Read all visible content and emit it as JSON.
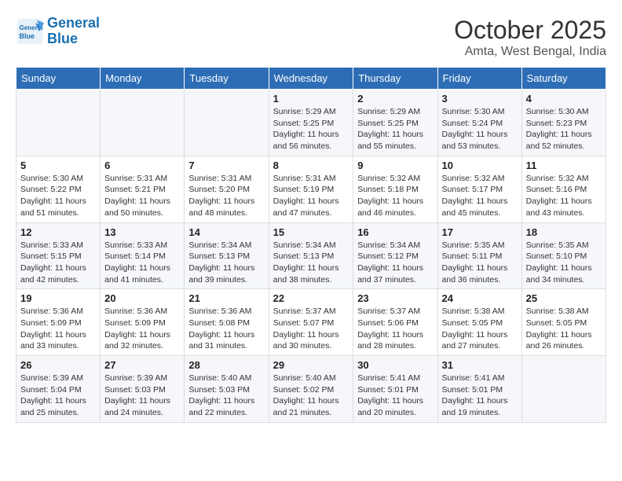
{
  "header": {
    "logo_line1": "General",
    "logo_line2": "Blue",
    "title": "October 2025",
    "subtitle": "Amta, West Bengal, India"
  },
  "weekdays": [
    "Sunday",
    "Monday",
    "Tuesday",
    "Wednesday",
    "Thursday",
    "Friday",
    "Saturday"
  ],
  "weeks": [
    [
      {
        "day": "",
        "info": ""
      },
      {
        "day": "",
        "info": ""
      },
      {
        "day": "",
        "info": ""
      },
      {
        "day": "1",
        "info": "Sunrise: 5:29 AM\nSunset: 5:25 PM\nDaylight: 11 hours and 56 minutes."
      },
      {
        "day": "2",
        "info": "Sunrise: 5:29 AM\nSunset: 5:25 PM\nDaylight: 11 hours and 55 minutes."
      },
      {
        "day": "3",
        "info": "Sunrise: 5:30 AM\nSunset: 5:24 PM\nDaylight: 11 hours and 53 minutes."
      },
      {
        "day": "4",
        "info": "Sunrise: 5:30 AM\nSunset: 5:23 PM\nDaylight: 11 hours and 52 minutes."
      }
    ],
    [
      {
        "day": "5",
        "info": "Sunrise: 5:30 AM\nSunset: 5:22 PM\nDaylight: 11 hours and 51 minutes."
      },
      {
        "day": "6",
        "info": "Sunrise: 5:31 AM\nSunset: 5:21 PM\nDaylight: 11 hours and 50 minutes."
      },
      {
        "day": "7",
        "info": "Sunrise: 5:31 AM\nSunset: 5:20 PM\nDaylight: 11 hours and 48 minutes."
      },
      {
        "day": "8",
        "info": "Sunrise: 5:31 AM\nSunset: 5:19 PM\nDaylight: 11 hours and 47 minutes."
      },
      {
        "day": "9",
        "info": "Sunrise: 5:32 AM\nSunset: 5:18 PM\nDaylight: 11 hours and 46 minutes."
      },
      {
        "day": "10",
        "info": "Sunrise: 5:32 AM\nSunset: 5:17 PM\nDaylight: 11 hours and 45 minutes."
      },
      {
        "day": "11",
        "info": "Sunrise: 5:32 AM\nSunset: 5:16 PM\nDaylight: 11 hours and 43 minutes."
      }
    ],
    [
      {
        "day": "12",
        "info": "Sunrise: 5:33 AM\nSunset: 5:15 PM\nDaylight: 11 hours and 42 minutes."
      },
      {
        "day": "13",
        "info": "Sunrise: 5:33 AM\nSunset: 5:14 PM\nDaylight: 11 hours and 41 minutes."
      },
      {
        "day": "14",
        "info": "Sunrise: 5:34 AM\nSunset: 5:13 PM\nDaylight: 11 hours and 39 minutes."
      },
      {
        "day": "15",
        "info": "Sunrise: 5:34 AM\nSunset: 5:13 PM\nDaylight: 11 hours and 38 minutes."
      },
      {
        "day": "16",
        "info": "Sunrise: 5:34 AM\nSunset: 5:12 PM\nDaylight: 11 hours and 37 minutes."
      },
      {
        "day": "17",
        "info": "Sunrise: 5:35 AM\nSunset: 5:11 PM\nDaylight: 11 hours and 36 minutes."
      },
      {
        "day": "18",
        "info": "Sunrise: 5:35 AM\nSunset: 5:10 PM\nDaylight: 11 hours and 34 minutes."
      }
    ],
    [
      {
        "day": "19",
        "info": "Sunrise: 5:36 AM\nSunset: 5:09 PM\nDaylight: 11 hours and 33 minutes."
      },
      {
        "day": "20",
        "info": "Sunrise: 5:36 AM\nSunset: 5:09 PM\nDaylight: 11 hours and 32 minutes."
      },
      {
        "day": "21",
        "info": "Sunrise: 5:36 AM\nSunset: 5:08 PM\nDaylight: 11 hours and 31 minutes."
      },
      {
        "day": "22",
        "info": "Sunrise: 5:37 AM\nSunset: 5:07 PM\nDaylight: 11 hours and 30 minutes."
      },
      {
        "day": "23",
        "info": "Sunrise: 5:37 AM\nSunset: 5:06 PM\nDaylight: 11 hours and 28 minutes."
      },
      {
        "day": "24",
        "info": "Sunrise: 5:38 AM\nSunset: 5:05 PM\nDaylight: 11 hours and 27 minutes."
      },
      {
        "day": "25",
        "info": "Sunrise: 5:38 AM\nSunset: 5:05 PM\nDaylight: 11 hours and 26 minutes."
      }
    ],
    [
      {
        "day": "26",
        "info": "Sunrise: 5:39 AM\nSunset: 5:04 PM\nDaylight: 11 hours and 25 minutes."
      },
      {
        "day": "27",
        "info": "Sunrise: 5:39 AM\nSunset: 5:03 PM\nDaylight: 11 hours and 24 minutes."
      },
      {
        "day": "28",
        "info": "Sunrise: 5:40 AM\nSunset: 5:03 PM\nDaylight: 11 hours and 22 minutes."
      },
      {
        "day": "29",
        "info": "Sunrise: 5:40 AM\nSunset: 5:02 PM\nDaylight: 11 hours and 21 minutes."
      },
      {
        "day": "30",
        "info": "Sunrise: 5:41 AM\nSunset: 5:01 PM\nDaylight: 11 hours and 20 minutes."
      },
      {
        "day": "31",
        "info": "Sunrise: 5:41 AM\nSunset: 5:01 PM\nDaylight: 11 hours and 19 minutes."
      },
      {
        "day": "",
        "info": ""
      }
    ]
  ]
}
